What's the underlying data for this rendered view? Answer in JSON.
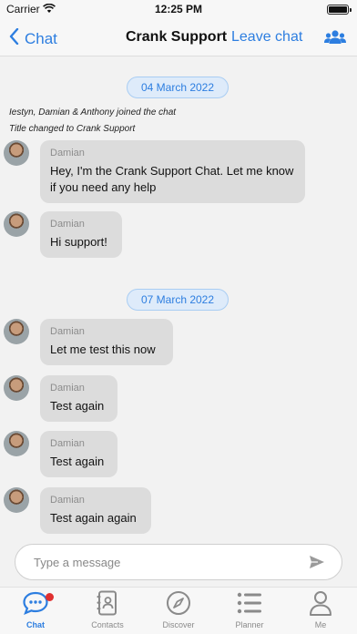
{
  "status_bar": {
    "carrier": "Carrier",
    "time": "12:25 PM"
  },
  "nav": {
    "back_label": "Chat",
    "title": "Crank Support",
    "leave_label": "Leave chat"
  },
  "chat": {
    "date1": "04 March 2022",
    "system1": "Iestyn, Damian & Anthony joined the chat",
    "system2": "Title changed to Crank Support",
    "date2": "07 March 2022",
    "messages": [
      {
        "sender": "Damian",
        "text": "Hey, I'm the Crank Support Chat. Let me know if you need any help"
      },
      {
        "sender": "Damian",
        "text": "Hi support!"
      },
      {
        "sender": "Damian",
        "text": "Let me test this now"
      },
      {
        "sender": "Damian",
        "text": "Test again"
      },
      {
        "sender": "Damian",
        "text": "Test again"
      },
      {
        "sender": "Damian",
        "text": "Test again again"
      }
    ]
  },
  "composer": {
    "placeholder": "Type a message",
    "value": ""
  },
  "tabs": [
    {
      "label": "Chat",
      "icon": "chat-bubble-icon",
      "active": true
    },
    {
      "label": "Contacts",
      "icon": "contacts-book-icon"
    },
    {
      "label": "Discover",
      "icon": "compass-icon"
    },
    {
      "label": "Planner",
      "icon": "list-icon"
    },
    {
      "label": "Me",
      "icon": "person-icon"
    }
  ],
  "colors": {
    "accent": "#2d7ee0",
    "bubble": "#dcdcdc",
    "badge": "#e03030"
  }
}
